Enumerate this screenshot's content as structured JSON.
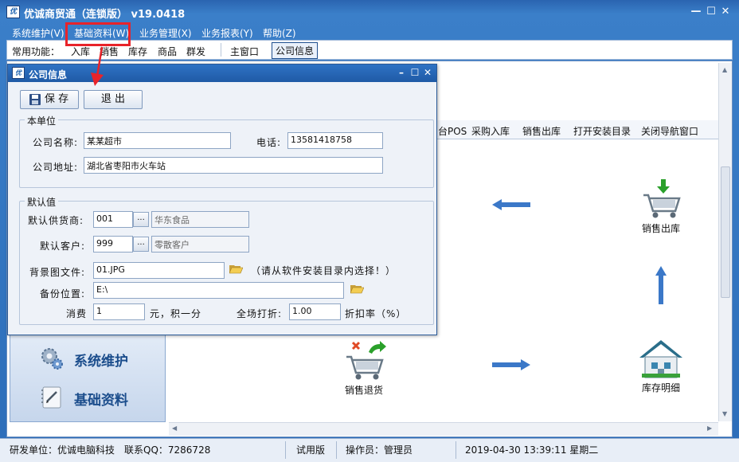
{
  "app": {
    "title": "优诚商贸通（连锁版）  v19.0418",
    "icon_text": "优"
  },
  "menu": [
    "系统维护(V)",
    "基础资料(W)",
    "业务管理(X)",
    "业务报表(Y)",
    "帮助(Z)"
  ],
  "quickbar": {
    "label": "常用功能：",
    "items": [
      "入库",
      "销售",
      "库存",
      "商品",
      "群发"
    ],
    "windows": [
      "主窗口",
      "公司信息"
    ]
  },
  "nav_tabs": [
    "台POS",
    "采购入库",
    "销售出库",
    "打开安装目录",
    "关闭导航窗口"
  ],
  "flow": {
    "sales_out": "销售出库",
    "sales_return": "销售退货",
    "stock_detail": "库存明细"
  },
  "sidebar": [
    {
      "label": "系统维护",
      "icon": "gears-icon"
    },
    {
      "label": "基础资料",
      "icon": "notebook-icon"
    }
  ],
  "dialog": {
    "title": "公司信息",
    "save_label": "保 存",
    "exit_label": "退 出",
    "group_unit": "本单位",
    "company_name_label": "公司名称:",
    "company_name": "某某超市",
    "phone_label": "电话:",
    "phone": "13581418758",
    "address_label": "公司地址:",
    "address": "湖北省枣阳市火车站",
    "group_defaults": "默认值",
    "supplier_label": "默认供货商:",
    "supplier_code": "001",
    "supplier_name": "华东食品",
    "customer_label": "默认客户:",
    "customer_code": "999",
    "customer_name": "零散客户",
    "bg_label": "背景图文件:",
    "bg_file": "01.JPG",
    "bg_hint": "（请从软件安装目录内选择！）",
    "backup_label": "备份位置:",
    "backup_path": "E:\\",
    "spend_label": "消费",
    "spend_value": "1",
    "points_label": "元，积一分",
    "discount_label": "全场打折:",
    "discount_value": "1.00",
    "discount_unit": "折扣率（%）"
  },
  "status": {
    "developer": "研发单位：优诚电脑科技",
    "qq": "联系QQ：7286728",
    "edition": "试用版",
    "operator": "操作员：管理员",
    "datetime": "2019-04-30 13:39:11 星期二"
  },
  "colors": {
    "titlebar": "#2c6db9",
    "highlight": "#e8232a",
    "sidebar_text": "#1b4d8c"
  }
}
